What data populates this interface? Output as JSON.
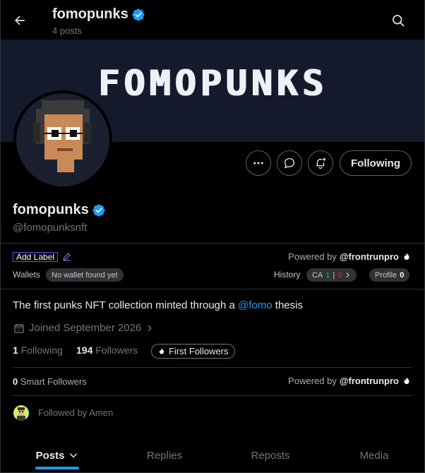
{
  "header": {
    "title": "fomopunks",
    "posts_count": "4 posts"
  },
  "banner": {
    "text": "FOMOPUNKS"
  },
  "profile": {
    "display_name": "fomopunks",
    "handle": "@fomopunksnft",
    "following_label": "Following",
    "bio_prefix": "The first punks NFT collection minted through a ",
    "bio_mention": "@fomo",
    "bio_suffix": " thesis",
    "joined": "Joined September 2026",
    "following_count": "1",
    "following_word": "Following",
    "followers_count": "194",
    "followers_word": "Followers",
    "first_followers_label": "First Followers",
    "followed_by": "Followed by Amen"
  },
  "extension": {
    "add_label": "Add Label",
    "powered_by": "Powered by",
    "powered_brand": "@frontrunpro",
    "wallets_label": "Wallets",
    "no_wallet": "No wallet found yet",
    "history_label": "History",
    "ca_label": "CA",
    "ca_green": "1",
    "ca_separator": "|",
    "ca_red": "0",
    "profile_label": "Profile",
    "profile_count": "0",
    "smart_count": "0",
    "smart_label": "Smart Followers"
  },
  "tabs": {
    "posts": "Posts",
    "replies": "Replies",
    "reposts": "Reposts",
    "media": "Media"
  },
  "colors": {
    "accent": "#1d9bf0",
    "verified": "#1d9bf0",
    "banner_bg": "#141a2b",
    "positive": "#00ba7c",
    "negative": "#f4212e"
  }
}
